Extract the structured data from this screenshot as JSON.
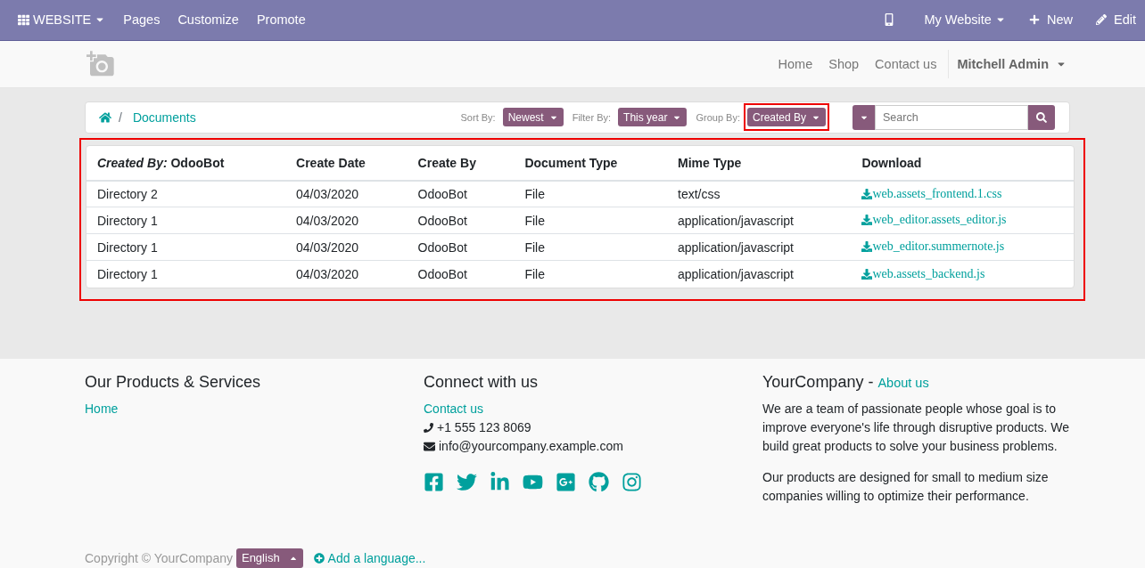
{
  "admin_bar": {
    "app_menu": "WEBSITE",
    "menu": [
      "Pages",
      "Customize",
      "Promote"
    ],
    "website": "My Website",
    "new": "New",
    "edit": "Edit"
  },
  "header": {
    "nav": [
      "Home",
      "Shop",
      "Contact us"
    ],
    "user": "Mitchell Admin"
  },
  "breadcrumb": {
    "separator": "/",
    "current": "Documents"
  },
  "filters": [
    {
      "label": "Sort By:",
      "value": "Newest",
      "highlighted": false
    },
    {
      "label": "Filter By:",
      "value": "This year",
      "highlighted": false
    },
    {
      "label": "Group By:",
      "value": "Created By",
      "highlighted": true
    }
  ],
  "search": {
    "placeholder": "Search"
  },
  "table": {
    "highlighted": true,
    "columns": [
      "*Created By:* OdooBot",
      "Create Date",
      "Create By",
      "Document Type",
      "Mime Type",
      "Download"
    ],
    "rows": [
      [
        "Directory 2",
        "04/03/2020",
        "OdooBot",
        "File",
        "text/css",
        "web.assets_frontend.1.css"
      ],
      [
        "Directory 1",
        "04/03/2020",
        "OdooBot",
        "File",
        "application/javascript",
        "web_editor.assets_editor.js"
      ],
      [
        "Directory 1",
        "04/03/2020",
        "OdooBot",
        "File",
        "application/javascript",
        "web_editor.summernote.js"
      ],
      [
        "Directory 1",
        "04/03/2020",
        "OdooBot",
        "File",
        "application/javascript",
        "web.assets_backend.js"
      ]
    ]
  },
  "footer": {
    "col1": {
      "title": "Our Products & Services",
      "links": [
        "Home"
      ]
    },
    "col2": {
      "title": "Connect with us",
      "link": "Contact us",
      "phone": "+1 555 123 8069",
      "email": "info@yourcompany.example.com"
    },
    "col3": {
      "title": "YourCompany",
      "separator": "-",
      "link": "About us",
      "paragraphs": [
        "We are a team of passionate people whose goal is to improve everyone's life through disruptive products. We build great products to solve your business problems.",
        "Our products are designed for small to medium size companies willing to optimize their performance."
      ]
    },
    "copyright": "Copyright © YourCompany",
    "language": "English",
    "add_language": "Add a language..."
  }
}
